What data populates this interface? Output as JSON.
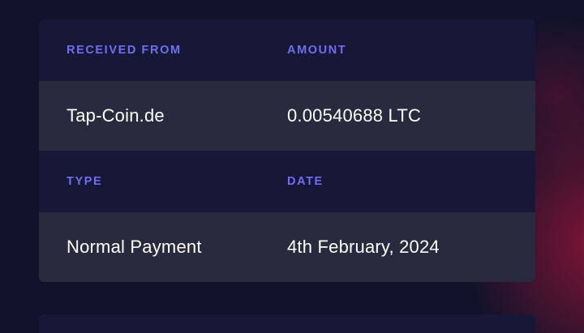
{
  "transaction_details": {
    "received_from": {
      "label": "RECEIVED FROM",
      "value": "Tap-Coin.de"
    },
    "amount": {
      "label": "AMOUNT",
      "value": "0.00540688 LTC"
    },
    "type": {
      "label": "TYPE",
      "value": "Normal Payment"
    },
    "date": {
      "label": "DATE",
      "value": "4th February, 2024"
    }
  },
  "colors": {
    "background": "#12132a",
    "card": "#171838",
    "value_row": "#2c2d40",
    "label_accent": "#6f6ef0",
    "value_text": "#ffffff",
    "glow_red": "#96143a"
  }
}
